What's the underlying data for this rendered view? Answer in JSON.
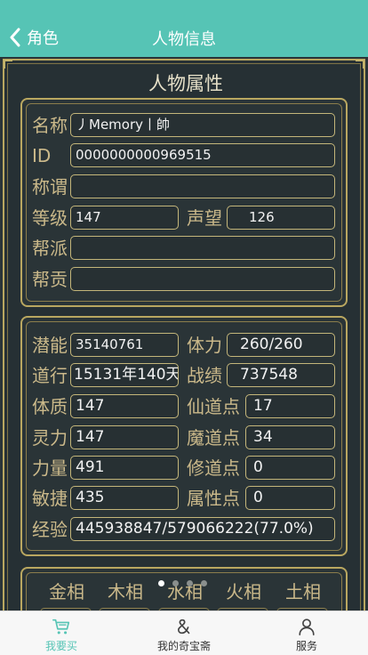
{
  "navbar": {
    "back_label": "角色",
    "title": "人物信息"
  },
  "section_title": "人物属性",
  "basic_info": {
    "name_label": "名称",
    "name_value": "丿Memory丨帥",
    "id_label": "ID",
    "id_value": "0000000000969515",
    "title_label": "称谓",
    "title_value": "",
    "level_label": "等级",
    "level_value": "147",
    "reputation_label": "声望",
    "reputation_value": "126",
    "faction_label": "帮派",
    "faction_value": "",
    "contribution_label": "帮贡",
    "contribution_value": ""
  },
  "stats": {
    "potential_label": "潜能",
    "potential_value": "35140761",
    "stamina_label": "体力",
    "stamina_value": "260/260",
    "taoism_label": "道行",
    "taoism_value": "15131年140天",
    "merit_label": "战绩",
    "merit_value": "737548",
    "constitution_label": "体质",
    "constitution_value": "147",
    "immortal_label": "仙道点",
    "immortal_value": "17",
    "spirit_label": "灵力",
    "spirit_value": "147",
    "demon_label": "魔道点",
    "demon_value": "34",
    "strength_label": "力量",
    "strength_value": "491",
    "cultivation_label": "修道点",
    "cultivation_value": "0",
    "agility_label": "敏捷",
    "agility_value": "435",
    "attribute_label": "属性点",
    "attribute_value": "0",
    "exp_label": "经验",
    "exp_value": "445938847/579066222(77.0%)"
  },
  "elements": {
    "metal": "金相",
    "wood": "木相",
    "water": "水相",
    "fire": "火相",
    "earth": "土相"
  },
  "pager": {
    "count": 4,
    "active_index": 0
  },
  "tabbar": {
    "buy_label": "我要买",
    "treasure_label": "我的奇宝斋",
    "service_label": "服务"
  },
  "colors": {
    "navbar": "#56c4b5",
    "background": "#2b3538",
    "gold_border": "#b9a760",
    "label_gold": "#cbb98a",
    "tab_active": "#56c4b5"
  },
  "icons": {
    "back": "chevron-left-icon",
    "buy": "cart-icon",
    "treasure": "ampersand-icon",
    "service": "person-icon"
  }
}
